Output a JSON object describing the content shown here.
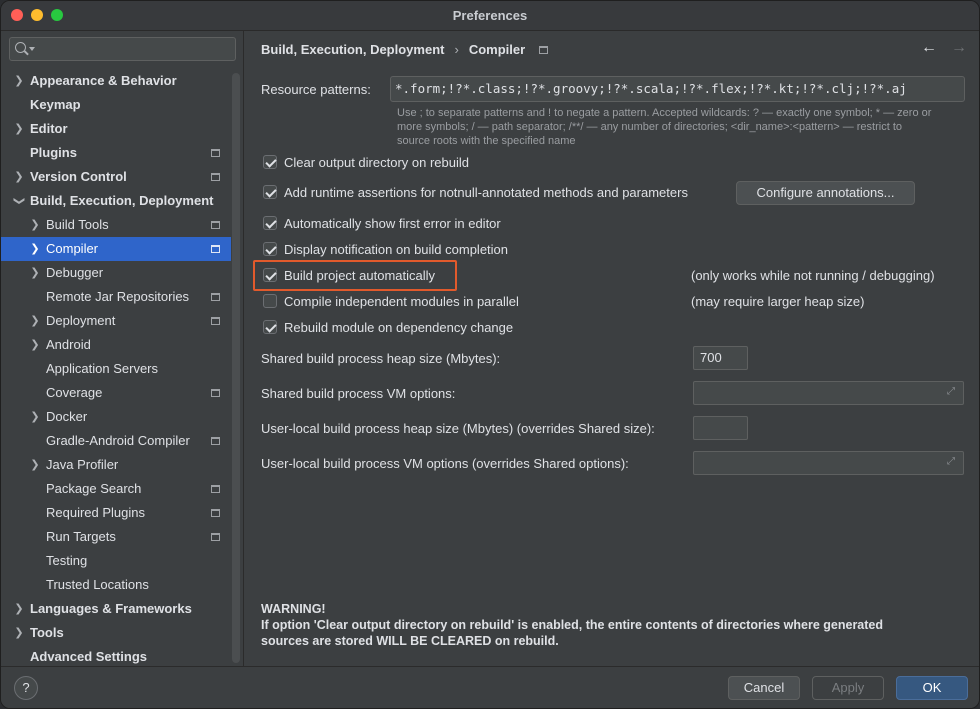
{
  "window": {
    "title": "Preferences"
  },
  "sidebar": {
    "search": {
      "placeholder": ""
    },
    "items": [
      {
        "label": "Appearance & Behavior"
      },
      {
        "label": "Keymap"
      },
      {
        "label": "Editor"
      },
      {
        "label": "Plugins"
      },
      {
        "label": "Version Control"
      },
      {
        "label": "Build, Execution, Deployment"
      },
      {
        "label": "Build Tools"
      },
      {
        "label": "Compiler"
      },
      {
        "label": "Debugger"
      },
      {
        "label": "Remote Jar Repositories"
      },
      {
        "label": "Deployment"
      },
      {
        "label": "Android"
      },
      {
        "label": "Application Servers"
      },
      {
        "label": "Coverage"
      },
      {
        "label": "Docker"
      },
      {
        "label": "Gradle-Android Compiler"
      },
      {
        "label": "Java Profiler"
      },
      {
        "label": "Package Search"
      },
      {
        "label": "Required Plugins"
      },
      {
        "label": "Run Targets"
      },
      {
        "label": "Testing"
      },
      {
        "label": "Trusted Locations"
      },
      {
        "label": "Languages & Frameworks"
      },
      {
        "label": "Tools"
      },
      {
        "label": "Advanced Settings"
      }
    ]
  },
  "breadcrumb": {
    "parent": "Build, Execution, Deployment",
    "separator": "›",
    "current": "Compiler"
  },
  "resource_patterns": {
    "label": "Resource patterns:",
    "value": "*.form;!?*.class;!?*.groovy;!?*.scala;!?*.flex;!?*.kt;!?*.clj;!?*.aj",
    "hint_1": "Use ; to separate patterns and ! to negate a pattern. Accepted wildcards: ? — exactly one symbol; * — zero or",
    "hint_2": "more symbols; / — path separator; /**/ — any number of directories; <dir_name>:<pattern> — restrict to",
    "hint_3": "source roots with the specified name"
  },
  "options": {
    "clear_output": {
      "label": "Clear output directory on rebuild",
      "checked": true
    },
    "runtime_assertions": {
      "label": "Add runtime assertions for notnull-annotated methods and parameters",
      "checked": true
    },
    "configure_annotations": "Configure annotations...",
    "show_first_error": {
      "label": "Automatically show first error in editor",
      "checked": true
    },
    "display_notification": {
      "label": "Display notification on build completion",
      "checked": true
    },
    "build_automatically": {
      "label": "Build project automatically",
      "checked": true,
      "note": "(only works while not running / debugging)"
    },
    "compile_parallel": {
      "label": "Compile independent modules in parallel",
      "checked": false,
      "note": "(may require larger heap size)"
    },
    "rebuild_on_dependency": {
      "label": "Rebuild module on dependency change",
      "checked": true
    }
  },
  "fields": {
    "shared_heap": {
      "label": "Shared build process heap size (Mbytes):",
      "value": "700"
    },
    "shared_vm": {
      "label": "Shared build process VM options:",
      "value": ""
    },
    "user_heap": {
      "label": "User-local build process heap size (Mbytes) (overrides Shared size):",
      "value": ""
    },
    "user_vm": {
      "label": "User-local build process VM options (overrides Shared options):",
      "value": ""
    }
  },
  "warning": {
    "title": "WARNING!",
    "line_1": "If option 'Clear output directory on rebuild' is enabled, the entire contents of directories where generated",
    "line_2": "sources are stored WILL BE CLEARED on rebuild."
  },
  "footer": {
    "help": "?",
    "cancel": "Cancel",
    "apply": "Apply",
    "ok": "OK"
  },
  "colors": {
    "selection": "#2f65ca",
    "highlight_border": "#e25a2c",
    "ok_button": "#365880"
  }
}
